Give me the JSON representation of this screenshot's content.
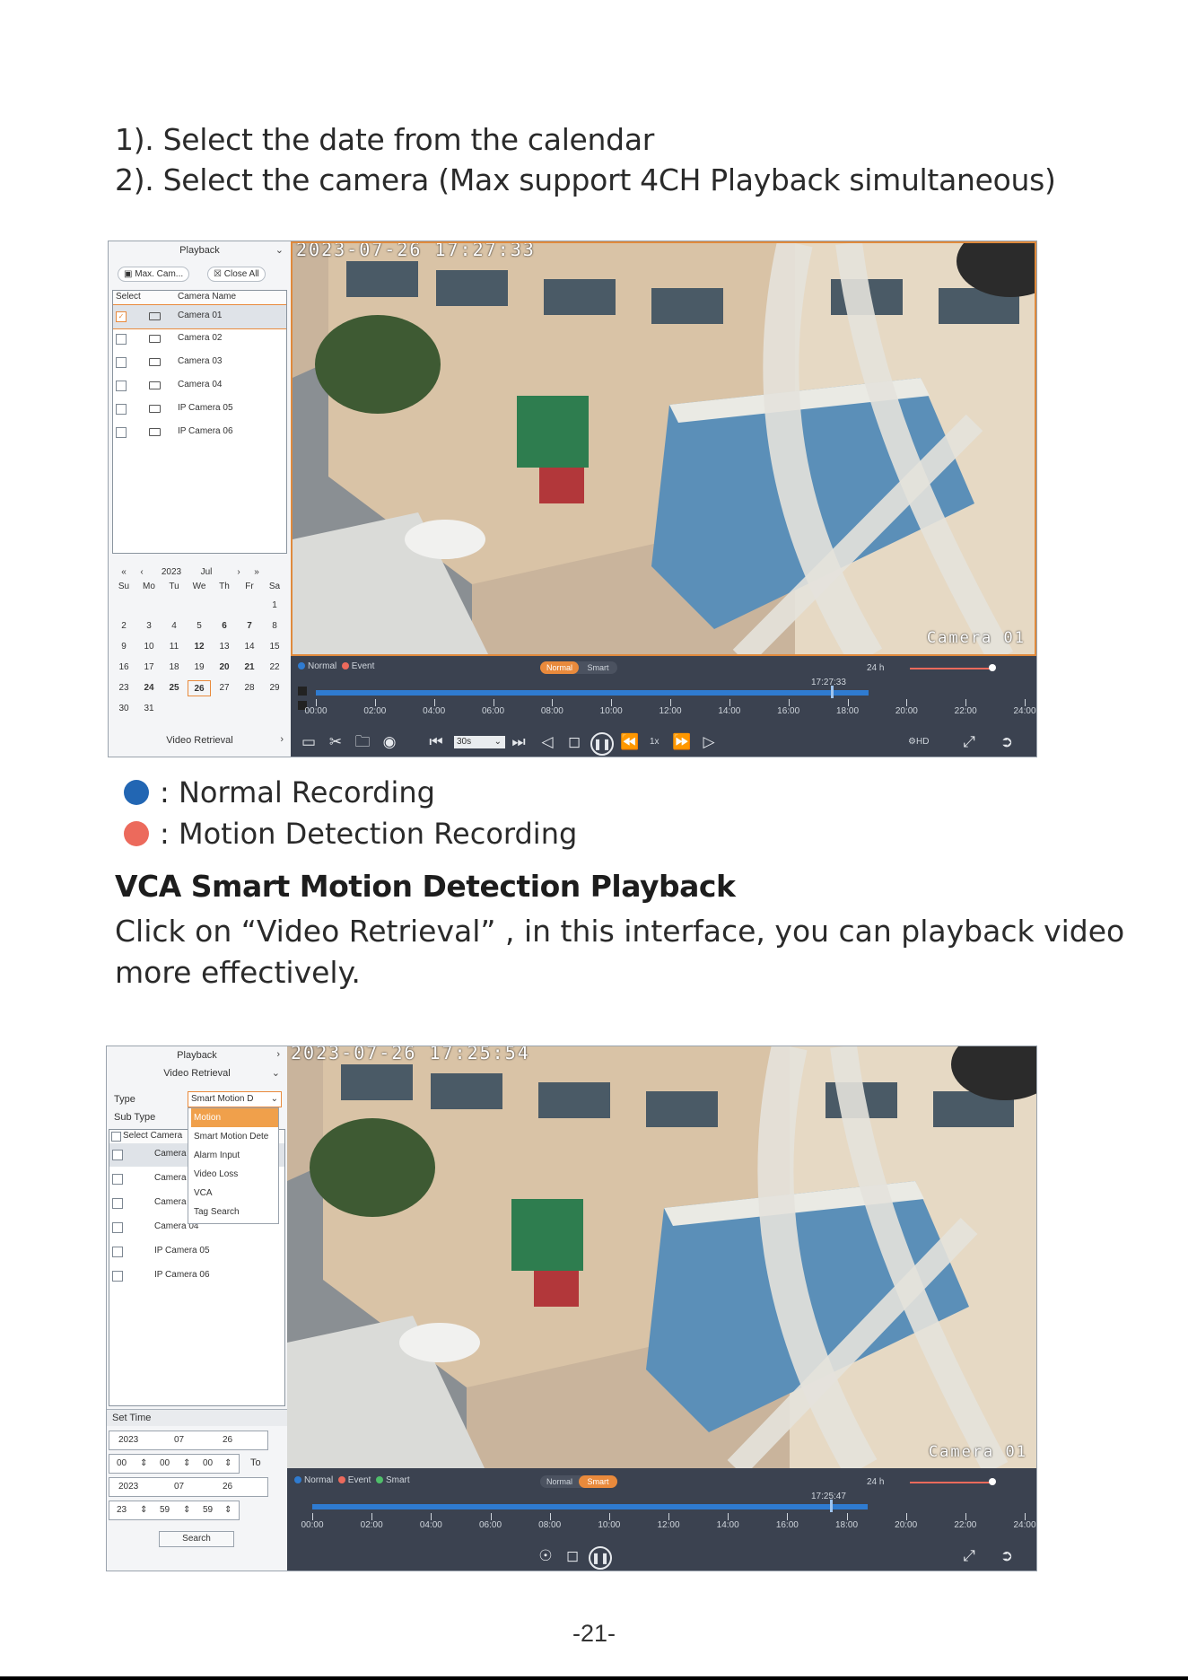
{
  "steps": [
    "1). Select the date from the calendar",
    "2). Select the camera (Max support 4CH Playback simultaneous)"
  ],
  "shot1": {
    "sidebar_title": "Playback",
    "max_cam_label": "Max. Cam...",
    "close_all_label": "Close All",
    "col_select": "Select",
    "col_camera_name": "Camera Name",
    "cameras": [
      "Camera 01",
      "Camera 02",
      "Camera 03",
      "Camera 04",
      "IP Camera 05",
      "IP Camera 06"
    ],
    "calendar": {
      "year": "2023",
      "month": "Jul",
      "weekdays": [
        "Su",
        "Mo",
        "Tu",
        "We",
        "Th",
        "Fr",
        "Sa"
      ],
      "weeks": [
        [
          "",
          "",
          "",
          "",
          "",
          "",
          "1"
        ],
        [
          "2",
          "3",
          "4",
          "5",
          "6",
          "7",
          "8"
        ],
        [
          "9",
          "10",
          "11",
          "12",
          "13",
          "14",
          "15"
        ],
        [
          "16",
          "17",
          "18",
          "19",
          "20",
          "21",
          "22"
        ],
        [
          "23",
          "24",
          "25",
          "26",
          "27",
          "28",
          "29"
        ],
        [
          "30",
          "31",
          "",
          "",
          "",
          "",
          ""
        ]
      ],
      "selected": "26",
      "bold_days": [
        "6",
        "7",
        "12",
        "20",
        "21",
        "24",
        "25",
        "26"
      ]
    },
    "video_retrieval_label": "Video Retrieval",
    "timestamp": "2023-07-26 17:27:33",
    "camera_overlay": "Camera 01",
    "legend_normal": "Normal",
    "legend_event": "Event",
    "mode_normal": "Normal",
    "mode_smart": "Smart",
    "range_label": "24 h",
    "cursor_time": "17:27:33",
    "hours": [
      "00:00",
      "02:00",
      "04:00",
      "06:00",
      "08:00",
      "10:00",
      "12:00",
      "14:00",
      "16:00",
      "18:00",
      "20:00",
      "22:00",
      "24:00"
    ],
    "interval": "30s",
    "speed": "1x",
    "quality": "HD"
  },
  "legend": {
    "normal": ": Normal Recording",
    "motion": ": Motion Detection Recording",
    "normal_color": "#2266b3",
    "motion_color": "#ec6a5c"
  },
  "section": {
    "heading": "VCA Smart Motion Detection Playback",
    "para_line1": "Click on “Video Retrieval” , in this interface, you can playback video",
    "para_line2": "more effectively."
  },
  "shot2": {
    "playback_label": "Playback",
    "video_retrieval_label": "Video Retrieval",
    "type_label": "Type",
    "type_value": "Smart Motion D",
    "subtype_label": "Sub Type",
    "dropdown": [
      "Motion",
      "Smart Motion Dete",
      "Alarm Input",
      "Video Loss",
      "VCA",
      "Tag Search"
    ],
    "col_select_camera": "Select Camera",
    "cameras": [
      "Camera",
      "Camera",
      "Camera",
      "Camera 04",
      "IP Camera 05",
      "IP Camera 06"
    ],
    "set_time_label": "Set Time",
    "start_date": [
      "2023",
      "07",
      "26"
    ],
    "start_time": [
      "00",
      "00",
      "00"
    ],
    "to_label": "To",
    "end_date": [
      "2023",
      "07",
      "26"
    ],
    "end_time": [
      "23",
      "59",
      "59"
    ],
    "search_label": "Search",
    "timestamp": "2023-07-26 17:25:54",
    "camera_overlay": "Camera 01",
    "legend_normal": "Normal",
    "legend_event": "Event",
    "legend_smart": "Smart",
    "mode_normal": "Normal",
    "mode_smart": "Smart",
    "range_label": "24 h",
    "cursor_time": "17:25:47",
    "hours": [
      "00:00",
      "02:00",
      "04:00",
      "06:00",
      "08:00",
      "10:00",
      "12:00",
      "14:00",
      "16:00",
      "18:00",
      "20:00",
      "22:00",
      "24:00"
    ]
  },
  "page_number": "-21-"
}
